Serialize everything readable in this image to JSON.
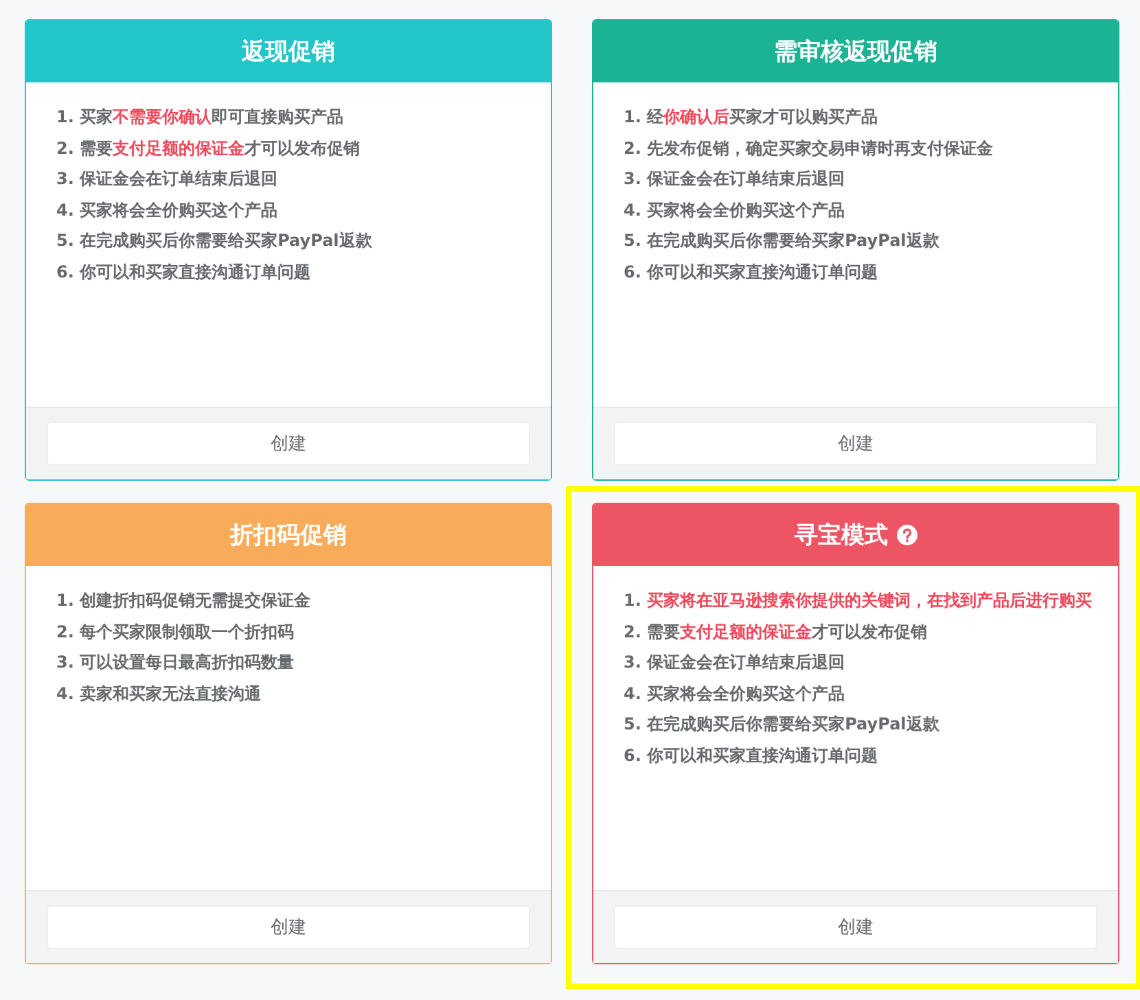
{
  "cards": [
    {
      "title": "返现促销",
      "color": "#22c5c8",
      "selected": false,
      "help_icon": false,
      "items": [
        [
          {
            "text": "1. 买家",
            "highlight": false
          },
          {
            "text": "不需要你确认",
            "highlight": true
          },
          {
            "text": "即可直接购买产品",
            "highlight": false
          }
        ],
        [
          {
            "text": "2. 需要",
            "highlight": false
          },
          {
            "text": "支付足额的保证金",
            "highlight": true
          },
          {
            "text": "才可以发布促销",
            "highlight": false
          }
        ],
        [
          {
            "text": "3. 保证金会在订单结束后退回",
            "highlight": false
          }
        ],
        [
          {
            "text": "4. 买家将会全价购买这个产品",
            "highlight": false
          }
        ],
        [
          {
            "text": "5. 在完成购买后你需要给买家PayPal返款",
            "highlight": false
          }
        ],
        [
          {
            "text": "6. 你可以和买家直接沟通订单问题",
            "highlight": false
          }
        ]
      ],
      "button": "创建"
    },
    {
      "title": "需审核返现促销",
      "color": "#1ab394",
      "selected": false,
      "help_icon": false,
      "items": [
        [
          {
            "text": "1. 经",
            "highlight": false
          },
          {
            "text": "你确认后",
            "highlight": true
          },
          {
            "text": "买家才可以购买产品",
            "highlight": false
          }
        ],
        [
          {
            "text": "2. 先发布促销，确定买家交易申请时再支付保证金",
            "highlight": false
          }
        ],
        [
          {
            "text": "3. 保证金会在订单结束后退回",
            "highlight": false
          }
        ],
        [
          {
            "text": "4. 买家将会全价购买这个产品",
            "highlight": false
          }
        ],
        [
          {
            "text": "5. 在完成购买后你需要给买家PayPal返款",
            "highlight": false
          }
        ],
        [
          {
            "text": "6. 你可以和买家直接沟通订单问题",
            "highlight": false
          }
        ]
      ],
      "button": "创建"
    },
    {
      "title": "折扣码促销",
      "color": "#f8ac59",
      "selected": false,
      "help_icon": false,
      "items": [
        [
          {
            "text": "1. 创建折扣码促销无需提交保证金",
            "highlight": false
          }
        ],
        [
          {
            "text": "2. 每个买家限制领取一个折扣码",
            "highlight": false
          }
        ],
        [
          {
            "text": "3. 可以设置每日最高折扣码数量",
            "highlight": false
          }
        ],
        [
          {
            "text": "4. 卖家和买家无法直接沟通",
            "highlight": false
          }
        ]
      ],
      "button": "创建"
    },
    {
      "title": "寻宝模式",
      "color": "#ed5565",
      "selected": true,
      "help_icon": true,
      "items": [
        [
          {
            "text": "1. ",
            "highlight": false
          },
          {
            "text": "买家将在亚马逊搜索你提供的关键词，在找到产品后进行购买",
            "highlight": true
          }
        ],
        [
          {
            "text": "2. 需要",
            "highlight": false
          },
          {
            "text": "支付足额的保证金",
            "highlight": true
          },
          {
            "text": "才可以发布促销",
            "highlight": false
          }
        ],
        [
          {
            "text": "3. 保证金会在订单结束后退回",
            "highlight": false
          }
        ],
        [
          {
            "text": "4. 买家将会全价购买这个产品",
            "highlight": false
          }
        ],
        [
          {
            "text": "5. 在完成购买后你需要给买家PayPal返款",
            "highlight": false
          }
        ],
        [
          {
            "text": "6. 你可以和买家直接沟通订单问题",
            "highlight": false
          }
        ]
      ],
      "button": "创建"
    }
  ]
}
